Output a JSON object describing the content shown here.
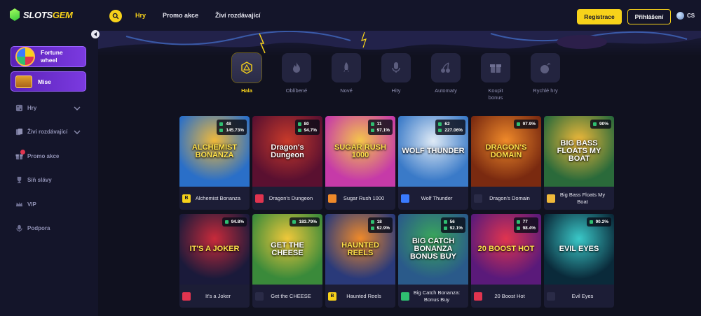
{
  "header": {
    "logo_prefix": "SLOTS",
    "logo_suffix": "GEM",
    "nav": [
      "Hry",
      "Promo akce",
      "Živí rozdávající"
    ],
    "register_label": "Registrace",
    "login_label": "Přihlášení",
    "language": "CS",
    "accent_color": "#f7d21a"
  },
  "sidebar": {
    "promos": [
      "Fortune wheel",
      "Mise"
    ],
    "items": [
      {
        "label": "Hry",
        "icon": "dice-icon",
        "expandable": true
      },
      {
        "label": "Živí rozdávající",
        "icon": "cards-icon",
        "expandable": true
      },
      {
        "label": "Promo akce",
        "icon": "gift-icon",
        "expandable": false
      },
      {
        "label": "Síň slávy",
        "icon": "trophy-icon",
        "expandable": false
      },
      {
        "label": "VIP",
        "icon": "crown-icon",
        "expandable": false
      },
      {
        "label": "Podpora",
        "icon": "headset-icon",
        "expandable": false
      }
    ]
  },
  "categories": [
    {
      "label": "Hala",
      "icon": "d20-icon",
      "active": true
    },
    {
      "label": "Oblíbené",
      "icon": "flame-icon",
      "active": false
    },
    {
      "label": "Nové",
      "icon": "rocket-icon",
      "active": false
    },
    {
      "label": "Hity",
      "icon": "microphone-icon",
      "active": false
    },
    {
      "label": "Automaty",
      "icon": "cherry-icon",
      "active": false
    },
    {
      "label": "Koupit\nbonus",
      "icon": "gift-box-icon",
      "active": false
    },
    {
      "label": "Rychlé hry",
      "icon": "bomb-icon",
      "active": false
    }
  ],
  "games": [
    {
      "name": "Alchemist Bonanza",
      "art": "ALCHEMIST BONANZA",
      "players": "48",
      "rtp": "145.73%",
      "provider": "B",
      "bg": "#2a6fc8",
      "bg2": "#f0b93a"
    },
    {
      "name": "Dragon's Dungeon",
      "art": "Dragon's Dungeon",
      "players": "80",
      "rtp": "94.7%",
      "provider": "",
      "bg": "#5a1030",
      "bg2": "#c83a2a"
    },
    {
      "name": "Sugar Rush 1000",
      "art": "SUGAR RUSH 1000",
      "players": "11",
      "rtp": "97.1%",
      "provider": "",
      "bg": "#c63aa8",
      "bg2": "#f5c64a"
    },
    {
      "name": "Wolf Thunder",
      "art": "WOLF THUNDER",
      "players": "62",
      "rtp": "227.06%",
      "provider": "",
      "bg": "#3a7ac8",
      "bg2": "#dfeaf5"
    },
    {
      "name": "Dragon's Domain",
      "art": "DRAGON'S DOMAIN",
      "players": "",
      "rtp": "97.9%",
      "provider": "",
      "bg": "#7a2a10",
      "bg2": "#f08a2a"
    },
    {
      "name": "Big Bass Floats My Boat",
      "art": "BIG BASS FLOATS MY BOAT",
      "players": "",
      "rtp": "90%",
      "provider": "",
      "bg": "#2a6a3a",
      "bg2": "#f0b93a"
    },
    {
      "name": "It's a Joker",
      "art": "IT'S A JOKER",
      "players": "",
      "rtp": "94.8%",
      "provider": "",
      "bg": "#1a1a3a",
      "bg2": "#c82a3a"
    },
    {
      "name": "Get the CHEESE",
      "art": "GET THE CHEESE",
      "players": "",
      "rtp": "183.79%",
      "provider": "",
      "bg": "#3a8a3a",
      "bg2": "#f0c83a"
    },
    {
      "name": "Haunted Reels",
      "art": "HAUNTED REELS",
      "players": "18",
      "rtp": "92.9%",
      "provider": "B",
      "bg": "#2a3a7a",
      "bg2": "#f08a2a"
    },
    {
      "name": "Big Catch Bonanza: Bonus Buy",
      "art": "BIG CATCH BONANZA BONUS BUY",
      "players": "56",
      "rtp": "92.1%",
      "provider": "",
      "bg": "#2a5a8a",
      "bg2": "#3aa85a"
    },
    {
      "name": "20 Boost Hot",
      "art": "20 BOOST HOT",
      "players": "77",
      "rtp": "98.4%",
      "provider": "",
      "bg": "#5a1a7a",
      "bg2": "#e0344f"
    },
    {
      "name": "Evil Eyes",
      "art": "EVIL EYES",
      "players": "",
      "rtp": "90.2%",
      "provider": "",
      "bg": "#0a2a3a",
      "bg2": "#3ac8c8"
    }
  ]
}
